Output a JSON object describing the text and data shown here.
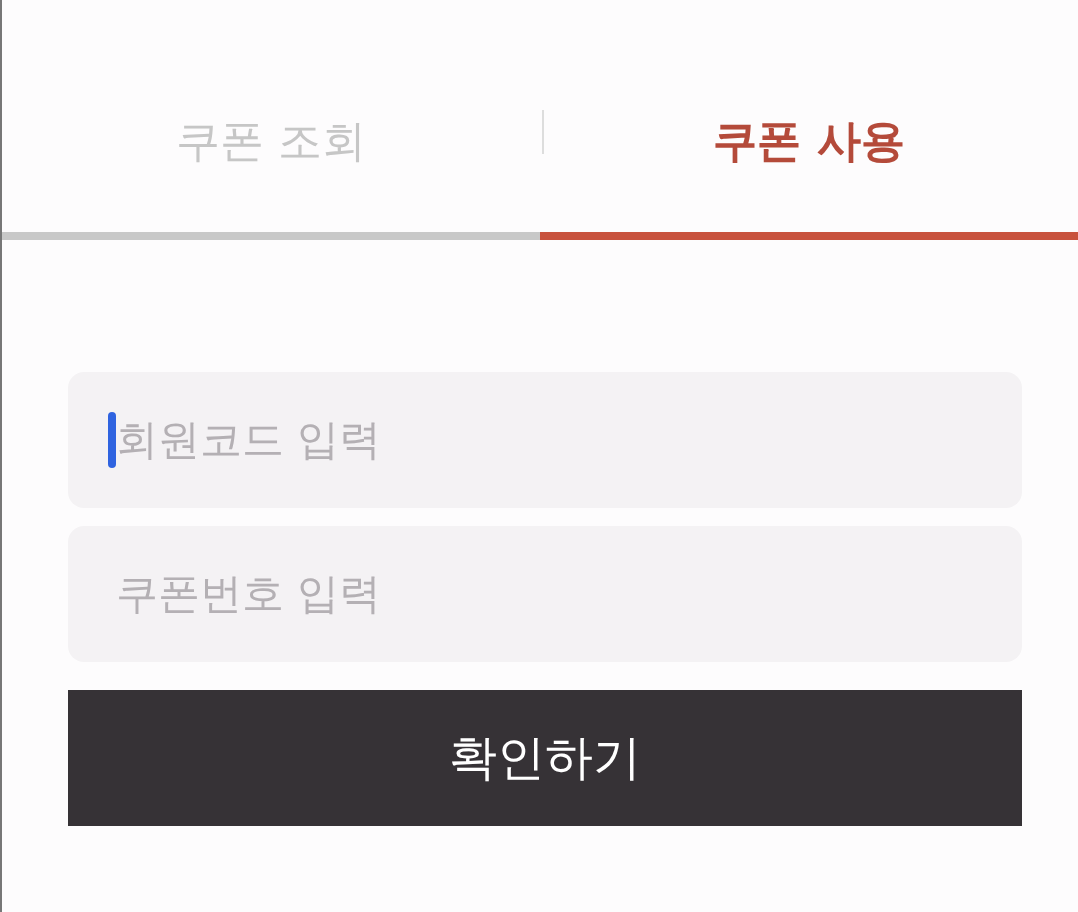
{
  "tabs": [
    {
      "label": "쿠폰 조회",
      "selected": false
    },
    {
      "label": "쿠폰 사용",
      "selected": true
    }
  ],
  "fields": [
    {
      "placeholder": "회원코드 입력",
      "focused": true
    },
    {
      "placeholder": "쿠폰번호 입력",
      "focused": false
    }
  ],
  "submit_button": {
    "label": "확인하기"
  }
}
